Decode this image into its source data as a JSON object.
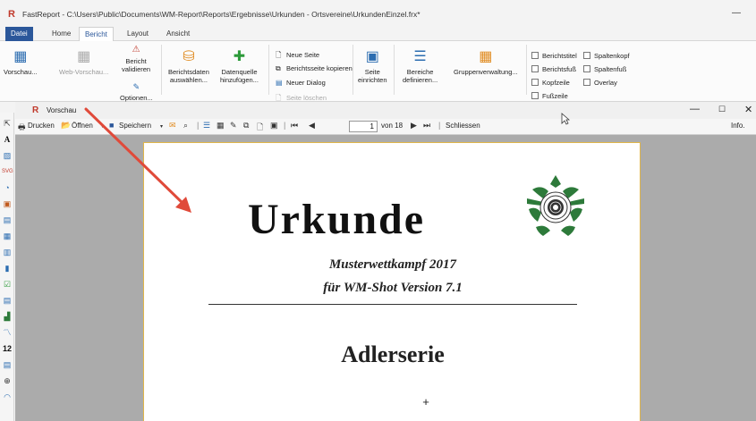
{
  "window": {
    "title": "FastReport - C:\\Users\\Public\\Documents\\WM-Report\\Reports\\Ergebnisse\\Urkunden - Ortsvereine\\UrkundenEinzel.frx*",
    "logo": "R",
    "minimize": "—"
  },
  "menu": {
    "tabs": [
      "Datei",
      "Home",
      "Bericht",
      "Layout",
      "Ansicht"
    ]
  },
  "ribbon": {
    "preview": "Vorschau...",
    "web_preview": "Web-Vorschau...",
    "validate": [
      "Bericht",
      "validieren"
    ],
    "options": "Optionen...",
    "report_data": [
      "Berichtsdaten",
      "auswählen..."
    ],
    "add_datasource": [
      "Datenquelle",
      "hinzufügen..."
    ],
    "new_page": "Neue Seite",
    "copy_page": "Berichtsseite kopieren",
    "new_dialog": "Neuer Dialog",
    "delete_page": "Seite löschen",
    "page_setup": [
      "Seite",
      "einrichten"
    ],
    "define_bands": [
      "Bereiche",
      "definieren..."
    ],
    "group_mgmt": "Gruppenverwaltung...",
    "checks": [
      "Berichtstitel",
      "Berichtsfuß",
      "Kopfzeile",
      "Fußzeile",
      "Spaltenkopf",
      "Spaltenfuß",
      "Overlay"
    ]
  },
  "preview": {
    "title": "Vorschau",
    "logo": "R",
    "toolbar": {
      "print": "Drucken",
      "open": "Öffnen",
      "save": "Speichern",
      "page_value": "1",
      "of_pages": "von 18",
      "close": "Schliessen",
      "info": "Info."
    }
  },
  "document": {
    "title": "Urkunde",
    "subtitle1": "Musterwettkampf 2017",
    "subtitle2": "für WM-Shot Version 7.1",
    "series": "Adlerserie",
    "plus": "+"
  },
  "colors": {
    "accent": "#2b579a",
    "logo": "#c0392b",
    "arrow": "#e04a3a",
    "page_border": "#e0b64a",
    "emblem": "#2d7a3a"
  }
}
